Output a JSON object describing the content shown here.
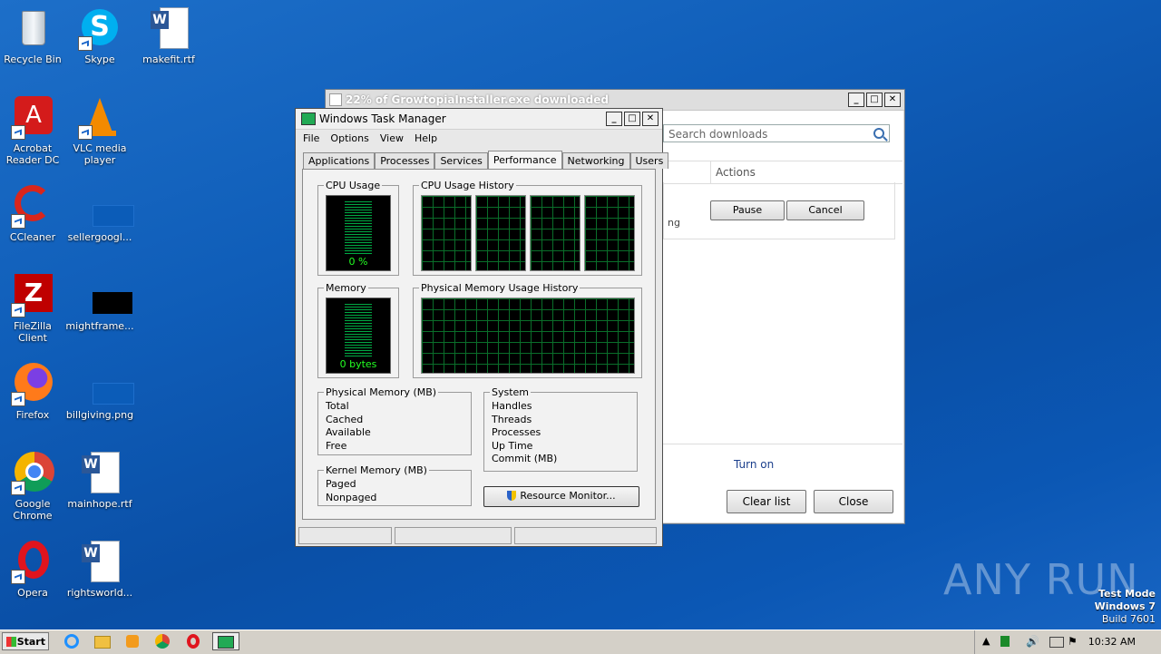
{
  "desktop": {
    "icons": [
      {
        "label": "Recycle Bin"
      },
      {
        "label": "Skype"
      },
      {
        "label": "makefit.rtf"
      },
      {
        "label": "Acrobat Reader DC"
      },
      {
        "label": "VLC media player"
      },
      {
        "label": "CCleaner"
      },
      {
        "label": "sellergoogl..."
      },
      {
        "label": "FileZilla Client"
      },
      {
        "label": "mightframe..."
      },
      {
        "label": "Firefox"
      },
      {
        "label": "billgiving.png"
      },
      {
        "label": "Google Chrome"
      },
      {
        "label": "mainhope.rtf"
      },
      {
        "label": "Opera"
      },
      {
        "label": "rightsworld..."
      }
    ]
  },
  "downloads_window": {
    "title": "22% of GrowtopiaInstaller.exe downloaded",
    "search_placeholder": "Search downloads",
    "column_actions": "Actions",
    "row_text_1": "",
    "row_text_2": "ng",
    "pause_label": "Pause",
    "cancel_label": "Cancel",
    "turn_on_label": "Turn on",
    "clear_list_label": "Clear list",
    "close_label": "Close"
  },
  "task_manager": {
    "title": "Windows Task Manager",
    "menu": [
      "File",
      "Options",
      "View",
      "Help"
    ],
    "tabs": [
      "Applications",
      "Processes",
      "Services",
      "Performance",
      "Networking",
      "Users"
    ],
    "active_tab": "Performance",
    "cpu_usage_title": "CPU Usage",
    "cpu_usage_value": "0 %",
    "cpu_history_title": "CPU Usage History",
    "memory_title": "Memory",
    "memory_value": "0 bytes",
    "phys_history_title": "Physical Memory Usage History",
    "phys_mem_group": "Physical Memory (MB)",
    "phys_mem_rows": [
      "Total",
      "Cached",
      "Available",
      "Free"
    ],
    "kernel_group": "Kernel Memory (MB)",
    "kernel_rows": [
      "Paged",
      "Nonpaged"
    ],
    "system_group": "System",
    "system_rows": [
      "Handles",
      "Threads",
      "Processes",
      "Up Time",
      "Commit (MB)"
    ],
    "resource_monitor_label": "Resource Monitor..."
  },
  "taskbar": {
    "start_label": "Start",
    "clock": "10:32 AM"
  },
  "watermark": {
    "line1": "Test Mode",
    "line2": "Windows 7",
    "line3": "Build 7601",
    "brand": "ANY RUN"
  }
}
